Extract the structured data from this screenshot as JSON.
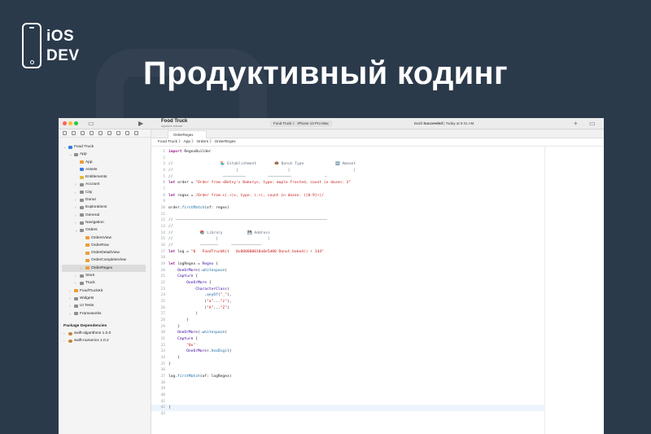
{
  "logo": {
    "line1": "iOS",
    "line2": "DEV"
  },
  "headline": "Продуктивный кодинг",
  "toolbar": {
    "project_title": "Food Truck",
    "project_subtitle": "appstore-release",
    "scheme_label": "Food Truck 〉 iPhone 13 Pro Max",
    "status_prefix": "Build",
    "status_bold": "Succeeded",
    "status_suffix": " | Today at 9:41 AM",
    "run_icon": "▶",
    "add_icon": "+"
  },
  "tab": {
    "label": "OrderRegex"
  },
  "jumpbar": "Food Truck 〉 App 〉 Orders 〉 OrderRegex",
  "navigator": {
    "items": [
      {
        "label": "Food Truck",
        "level": 0,
        "chev": "⌄",
        "color": "#3a7be0"
      },
      {
        "label": "App",
        "level": 1,
        "chev": "⌄",
        "color": "#8e8e8e"
      },
      {
        "label": "App",
        "level": 2,
        "chev": "",
        "color": "#f09a37"
      },
      {
        "label": "Assets",
        "level": 2,
        "chev": "",
        "color": "#3a7be0"
      },
      {
        "label": "Entitlements",
        "level": 2,
        "chev": "",
        "color": "#e2b93b"
      },
      {
        "label": "Account",
        "level": 2,
        "chev": "›",
        "color": "#8e8e8e"
      },
      {
        "label": "City",
        "level": 2,
        "chev": "›",
        "color": "#8e8e8e"
      },
      {
        "label": "Donut",
        "level": 2,
        "chev": "›",
        "color": "#8e8e8e"
      },
      {
        "label": "Explorations",
        "level": 2,
        "chev": "›",
        "color": "#8e8e8e"
      },
      {
        "label": "General",
        "level": 2,
        "chev": "›",
        "color": "#8e8e8e"
      },
      {
        "label": "Navigation",
        "level": 2,
        "chev": "›",
        "color": "#8e8e8e"
      },
      {
        "label": "Orders",
        "level": 2,
        "chev": "⌄",
        "color": "#8e8e8e"
      },
      {
        "label": "OrdersView",
        "level": 3,
        "chev": "",
        "color": "#f09a37"
      },
      {
        "label": "OrderRow",
        "level": 3,
        "chev": "",
        "color": "#f09a37"
      },
      {
        "label": "OrderDetailView",
        "level": 3,
        "chev": "",
        "color": "#f09a37"
      },
      {
        "label": "OrderCompleteView",
        "level": 3,
        "chev": "",
        "color": "#f09a37"
      },
      {
        "label": "OrderRegex",
        "level": 3,
        "chev": "›",
        "color": "#f09a37",
        "selected": true
      },
      {
        "label": "Store",
        "level": 2,
        "chev": "›",
        "color": "#8e8e8e"
      },
      {
        "label": "Truck",
        "level": 2,
        "chev": "›",
        "color": "#8e8e8e"
      },
      {
        "label": "FoodTruckKit",
        "level": 1,
        "chev": "›",
        "color": "#f09a37"
      },
      {
        "label": "Widgets",
        "level": 1,
        "chev": "›",
        "color": "#8e8e8e"
      },
      {
        "label": "UI Tests",
        "level": 1,
        "chev": "›",
        "color": "#8e8e8e"
      },
      {
        "label": "Frameworks",
        "level": 1,
        "chev": "›",
        "color": "#8e8e8e"
      }
    ],
    "packages_header": "Package Dependencies",
    "packages": [
      {
        "label": "swift-algorithms 1.0.0"
      },
      {
        "label": "swift-numerics 1.0.2"
      }
    ]
  },
  "code": [
    {
      "n": "1",
      "h": "<span class='k'>import</span> RegexBuilder"
    },
    {
      "n": "2",
      "h": ""
    },
    {
      "n": "3",
      "h": "<span class='c'>//                     🏪 Establishment        🍩 Donut Type              🔢 Amount</span>"
    },
    {
      "n": "4",
      "h": "<span class='c'>//                            |                      |                            |</span>"
    },
    {
      "n": "5",
      "h": "<span class='c'>//                      <span class='dash'>—————————————</span>          <span class='dash'>—————————————</span>               <span class='dash'>—</span></span>"
    },
    {
      "n": "6",
      "h": "<span class='k'>let</span> order = <span class='s'>\"Order from &lt;Betsy's Bakery&gt;, type: maple frosted, count in dozen: 3\"</span>"
    },
    {
      "n": "7",
      "h": ""
    },
    {
      "n": "8",
      "h": "<span class='k'>let</span> regex = <span class='s'>/Order from &lt;(.+)&gt;, type: (.+), count in dozen: ([0-9]+)/</span>"
    },
    {
      "n": "9",
      "h": ""
    },
    {
      "n": "10",
      "h": "order.<span class='b'>firstMatch</span>(of: regex)"
    },
    {
      "n": "11",
      "h": ""
    },
    {
      "n": "12",
      "h": "<span class='c'>// <span class='dash'>——————————————————————————————————————————————————————————————————————————————————————</span></span>"
    },
    {
      "n": "13",
      "h": "<span class='c'>//</span>"
    },
    {
      "n": "14",
      "h": "<span class='c'>//            📚 Library           💾 Address</span>"
    },
    {
      "n": "15",
      "h": "<span class='c'>//                   |                      |</span>"
    },
    {
      "n": "16",
      "h": "<span class='c'>//            <span class='dash'>——————————</span>      <span class='dash'>—————————————————</span></span>"
    },
    {
      "n": "17",
      "h": "<span class='k'>let</span> log = <span class='s'>\"0   FoodTruckKit   0x000000010a0e5d80 Donut.baked() + 144\"</span>"
    },
    {
      "n": "18",
      "h": ""
    },
    {
      "n": "19",
      "h": "<span class='k'>let</span> logRegex = <span class='t'>Regex</span> {"
    },
    {
      "n": "20",
      "h": "    <span class='t'>OneOrMore</span>(.<span class='b'>whitespace</span>)"
    },
    {
      "n": "21",
      "h": "    <span class='t'>Capture</span> {"
    },
    {
      "n": "22",
      "h": "        <span class='t'>OneOrMore</span> {"
    },
    {
      "n": "23",
      "h": "            <span class='t'>CharacterClass</span>("
    },
    {
      "n": "24",
      "h": "                .<span class='b'>anyOf</span>(<span class='s'>\"_\"</span>),"
    },
    {
      "n": "25",
      "h": "                (<span class='s'>\"a\"</span>...<span class='s'>\"z\"</span>),"
    },
    {
      "n": "26",
      "h": "                (<span class='s'>\"A\"</span>...<span class='s'>\"Z\"</span>)"
    },
    {
      "n": "27",
      "h": "            )"
    },
    {
      "n": "28",
      "h": "        }"
    },
    {
      "n": "29",
      "h": "    }"
    },
    {
      "n": "30",
      "h": "    <span class='t'>OneOrMore</span>(.<span class='b'>whitespace</span>)"
    },
    {
      "n": "31",
      "h": "    <span class='t'>Capture</span> {"
    },
    {
      "n": "32",
      "h": "        <span class='s'>\"0x\"</span>"
    },
    {
      "n": "33",
      "h": "        <span class='t'>OneOrMore</span>(.<span class='b'>hexDigit</span>)"
    },
    {
      "n": "34",
      "h": "    }"
    },
    {
      "n": "35",
      "h": "}"
    },
    {
      "n": "36",
      "h": ""
    },
    {
      "n": "37",
      "h": "log.<span class='b'>firstMatch</span>(of: logRegex)"
    },
    {
      "n": "38",
      "h": ""
    },
    {
      "n": "39",
      "h": ""
    },
    {
      "n": "40",
      "h": ""
    },
    {
      "n": "41",
      "h": ""
    },
    {
      "n": "42",
      "h": "|",
      "cur": true
    },
    {
      "n": "43",
      "h": ""
    }
  ]
}
